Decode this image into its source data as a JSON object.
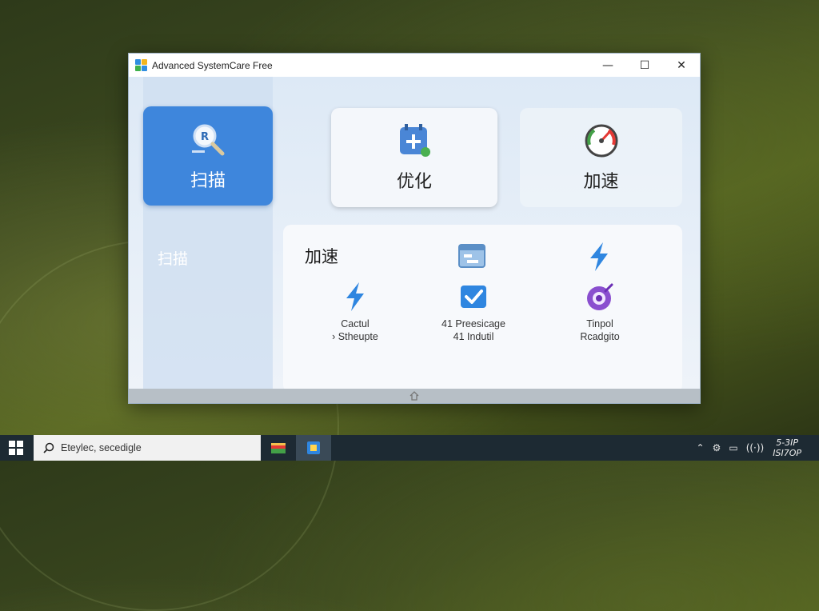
{
  "window": {
    "title": "Advanced SystemCare Free",
    "controls": {
      "minimize": "—",
      "maximize": "☐",
      "close": "✕"
    }
  },
  "tiles": [
    {
      "label": "扫描",
      "icon": "scan-magnifier-icon"
    },
    {
      "label": "优化",
      "icon": "calendar-plus-icon"
    },
    {
      "label": "加速",
      "icon": "speedometer-icon"
    }
  ],
  "sidebar": {
    "active_label": "扫描"
  },
  "panel": {
    "title": "加速",
    "features": [
      {
        "line1": "Cactul",
        "line2": "› Stheupte",
        "icon": "lightning-icon"
      },
      {
        "line1": "41 Preesicage",
        "line2": "41 Indutil",
        "icon": "check-box-icon"
      },
      {
        "line1": "Tinpol",
        "line2": "Rcadgito",
        "icon": "purple-target-icon"
      }
    ],
    "top_icons": [
      "window-settings-icon",
      "lightning-icon"
    ]
  },
  "taskbar": {
    "search_text": "Eteylec, secedigle",
    "clock_line1": "5-3IP",
    "clock_line2": "ISI7OP"
  },
  "colors": {
    "accent": "#3e86dc",
    "taskbar": "#1d2a33"
  }
}
